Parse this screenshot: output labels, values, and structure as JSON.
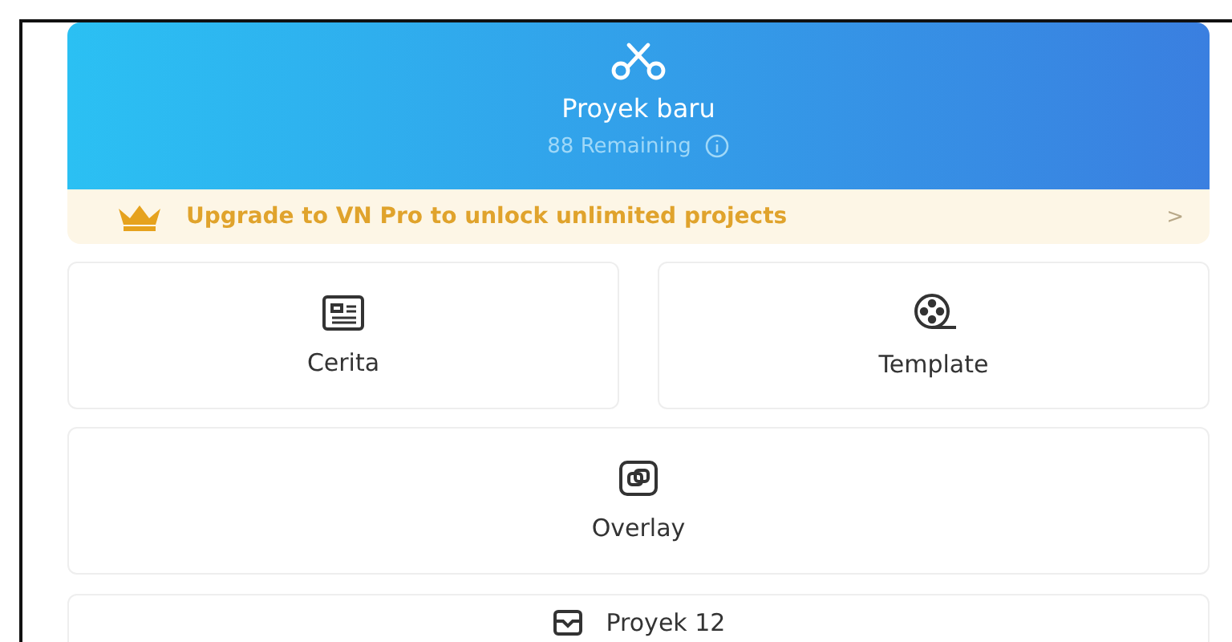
{
  "new_project": {
    "title": "Proyek baru",
    "remaining": "88 Remaining"
  },
  "upgrade_banner": {
    "text": "Upgrade to VN Pro to unlock unlimited projects",
    "chevron": ">"
  },
  "tiles": [
    {
      "kind": "story",
      "label": "Cerita"
    },
    {
      "kind": "template",
      "label": "Template"
    },
    {
      "kind": "overlay",
      "label": "Overlay"
    }
  ],
  "projects_bar": {
    "label": "Proyek 12"
  }
}
